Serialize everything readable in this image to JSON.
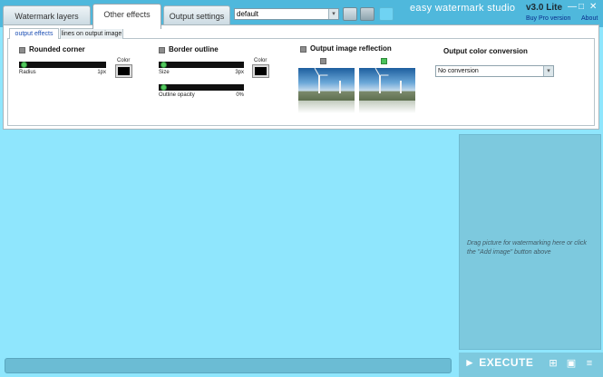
{
  "tabs": [
    {
      "label": "Watermark layers"
    },
    {
      "label": "Other effects"
    },
    {
      "label": "Output settings"
    }
  ],
  "preset": {
    "value": "default",
    "arrow": "▾"
  },
  "app": {
    "title": "easy watermark studio",
    "version": "v3.0 Lite",
    "buy_pro": "Buy Pro version",
    "about": "About",
    "min": "—",
    "max": "□",
    "close": "✕"
  },
  "subtabs": [
    {
      "label": "output effects"
    },
    {
      "label": "lines on output image"
    }
  ],
  "rounded_corner": {
    "title": "Rounded corner",
    "color_label": "Color",
    "color": "#000000",
    "radius": {
      "label": "Radius",
      "value": "1px"
    }
  },
  "border_outline": {
    "title": "Border outline",
    "color_label": "Color",
    "color": "#000000",
    "size": {
      "label": "Size",
      "value": "3px"
    },
    "opacity": {
      "label": "Outline opacity",
      "value": "0%"
    }
  },
  "reflection": {
    "title": "Output image reflection",
    "options": [
      {
        "checked": false
      },
      {
        "checked": true
      }
    ]
  },
  "color_conversion": {
    "title": "Output color conversion",
    "value": "No conversion",
    "arrow": "▾"
  },
  "workspace": {
    "drop_hint": "Drag picture for watermarking here or click the \"Add image\" button above"
  },
  "bottom": {
    "execute": "► EXECUTE",
    "icons": [
      "add-image-icon",
      "add-folder-icon",
      "clear-list-icon"
    ],
    "icon_glyphs": [
      "⊞",
      "▣",
      "≡"
    ]
  },
  "colors": {
    "window_bg": "#8fe6fd",
    "topbar": "#4fb8dc",
    "drop_zone": "#7dc9de",
    "slider_knob": "#53c95e"
  }
}
